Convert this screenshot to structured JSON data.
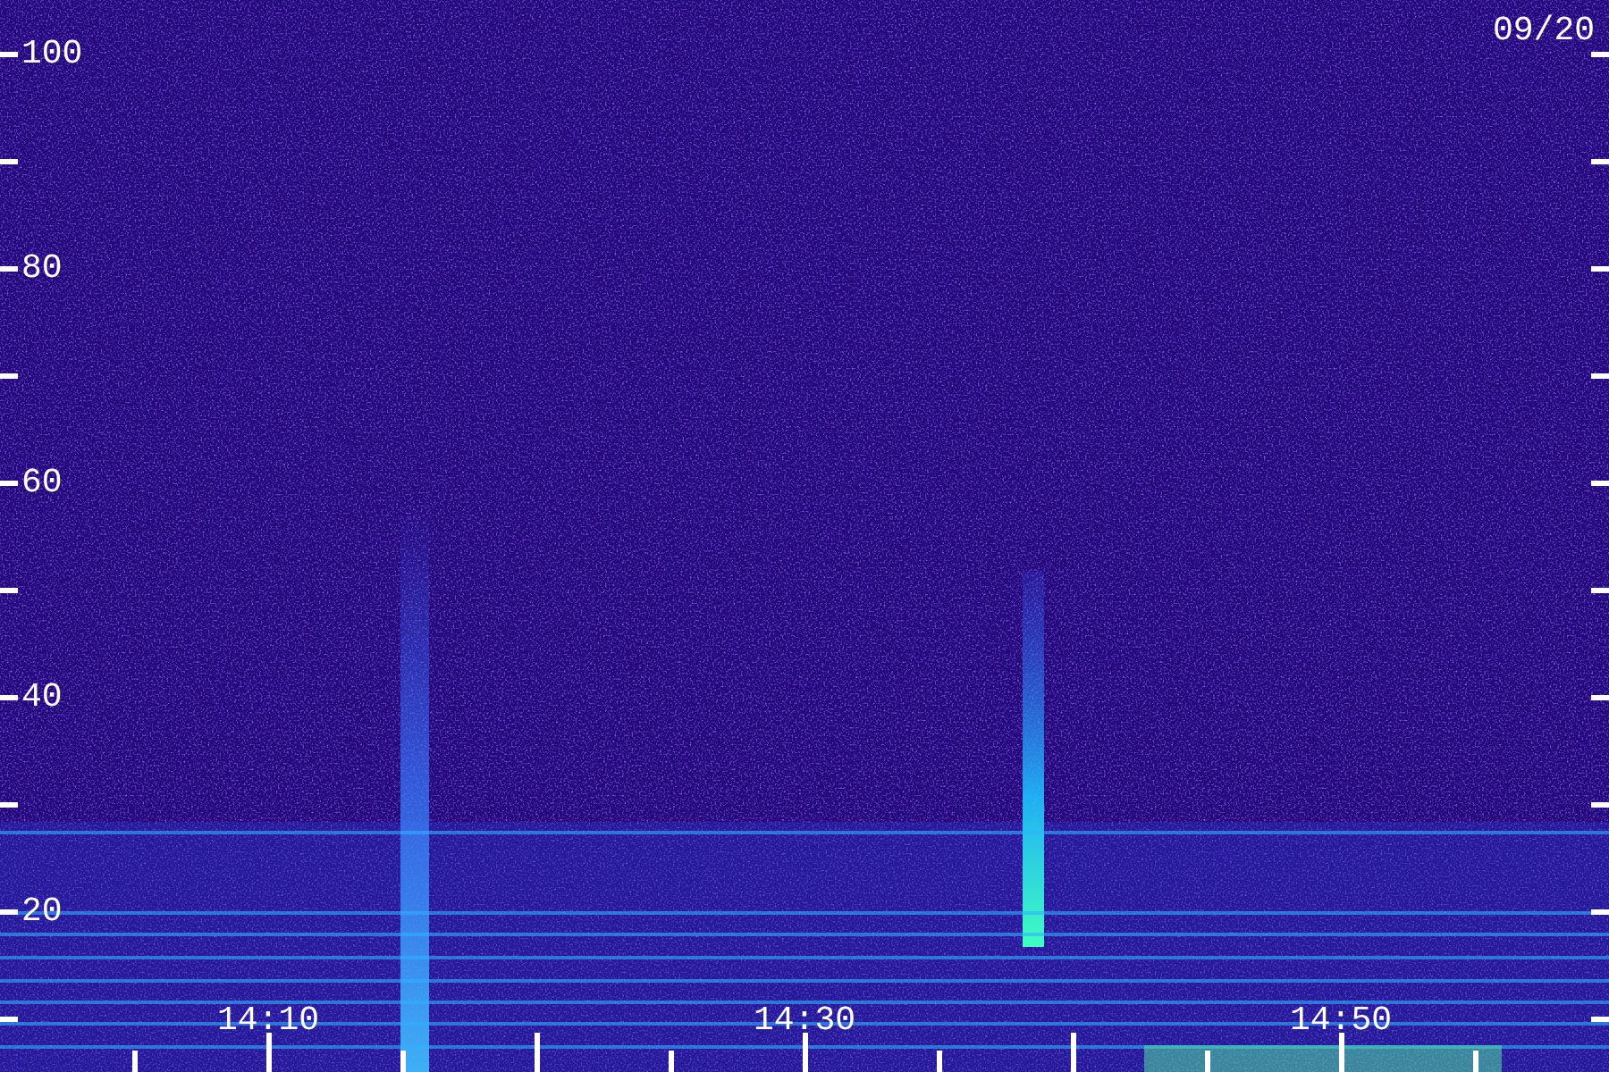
{
  "date": "09/20",
  "y_axis": {
    "labels": [
      "100",
      "80",
      "60",
      "40",
      "20"
    ]
  },
  "x_axis": {
    "labels": [
      "14:10",
      "14:30",
      "14:50"
    ]
  }
}
